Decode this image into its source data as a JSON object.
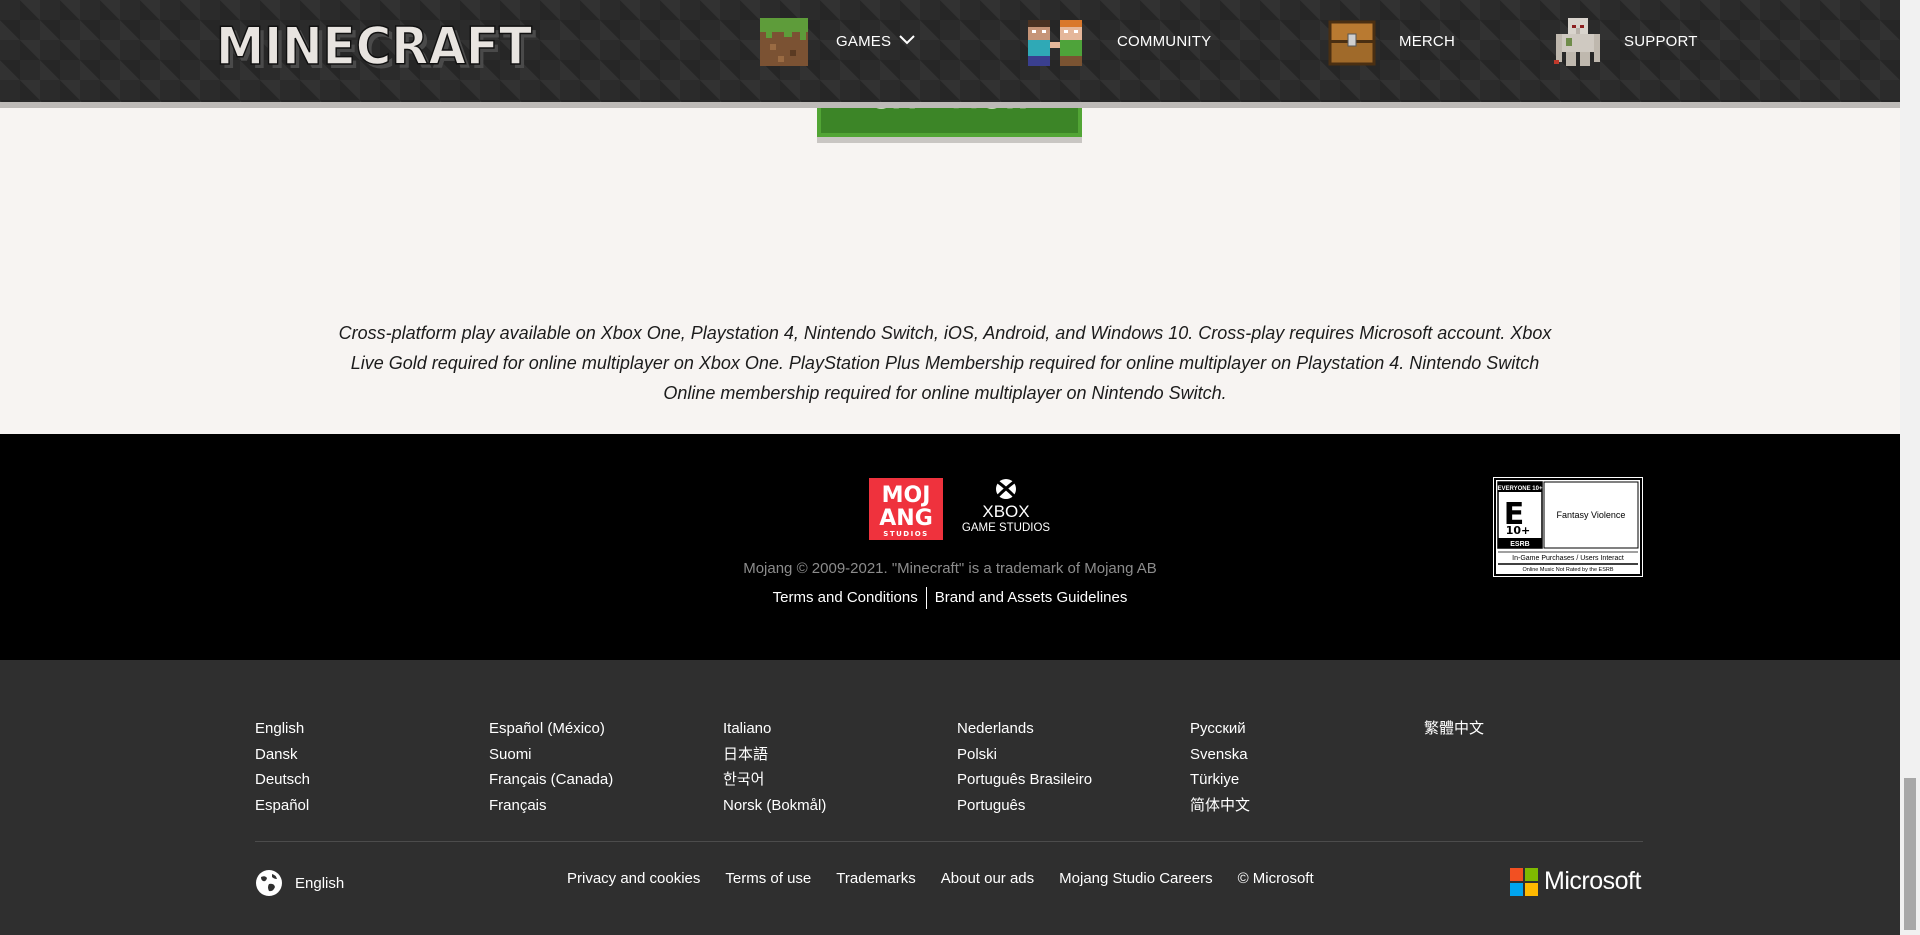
{
  "header": {
    "logo_text": "MINECRAFT",
    "nav": [
      {
        "label": "GAMES",
        "icon": "grass-block-icon"
      },
      {
        "label": "COMMUNITY",
        "icon": "steve-alex-icon"
      },
      {
        "label": "MERCH",
        "icon": "chest-icon"
      },
      {
        "label": "SUPPORT",
        "icon": "iron-golem-icon"
      }
    ]
  },
  "load_more": {
    "label": "LOAD MORE"
  },
  "disclaimer": "Cross-platform play available on Xbox One, Playstation 4, Nintendo Switch, iOS, Android, and Windows 10. Cross-play requires Microsoft account. Xbox Live Gold required for online multiplayer on Xbox One. PlayStation Plus Membership required for online multiplayer on Playstation 4. Nintendo Switch Online membership required for online multiplayer on Nintendo Switch.",
  "footer": {
    "mojang_logo": {
      "line1": "MOJ",
      "line2": "ANG",
      "line3": "STUDIOS"
    },
    "xbox_logo": {
      "line1": "XBOX",
      "line2": "GAME STUDIOS"
    },
    "copyright": "Mojang © 2009-2021. \"Minecraft\" is a trademark of Mojang AB",
    "links": [
      "Terms and Conditions",
      "Brand and Assets Guidelines"
    ],
    "esrb": {
      "rating_top": "EVERYONE 10+",
      "rating_letter": "E",
      "rating_num": "10+",
      "esrb_label": "ESRB",
      "descriptor": "Fantasy Violence",
      "interactive": "In-Game Purchases / Users Interact",
      "note": "Online Music Not Rated by the ESRB"
    }
  },
  "languages": {
    "col1": [
      "English",
      "Dansk",
      "Deutsch",
      "Español"
    ],
    "col2": [
      "Español (México)",
      "Suomi",
      "Français (Canada)",
      "Français"
    ],
    "col3": [
      "Italiano",
      "日本語",
      "한국어",
      "Norsk (Bokmål)"
    ],
    "col4": [
      "Nederlands",
      "Polski",
      "Português Brasileiro",
      "Português"
    ],
    "col5": [
      "Русский",
      "Svenska",
      "Türkiye",
      "简体中文"
    ],
    "col6": [
      "繁體中文"
    ]
  },
  "bottom": {
    "locale": "English",
    "links": [
      "Privacy and cookies",
      "Terms of use",
      "Trademarks",
      "About our ads",
      "Mojang Studio Careers",
      "© Microsoft"
    ],
    "microsoft": "Microsoft"
  },
  "colors": {
    "header_bg": "#2b2b2b",
    "button_green": "#3c8527",
    "footer_black": "#000000",
    "footer_grey": "#2f2f2f",
    "page_bg": "#f7f4f2"
  }
}
